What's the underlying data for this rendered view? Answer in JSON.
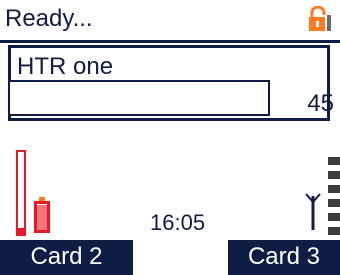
{
  "status": {
    "text": "Ready..."
  },
  "panel": {
    "title": "HTR one",
    "value": "45"
  },
  "time": "16:05",
  "softkeys": {
    "left": "Card 2",
    "right": "Card 3"
  },
  "colors": {
    "primary": "#0f1d45",
    "red": "#e61a24",
    "orange": "#ff7a21",
    "lock_gray": "#6a6a6a"
  },
  "indicators": {
    "battery_level": 0.08,
    "signal_bars": 6
  }
}
